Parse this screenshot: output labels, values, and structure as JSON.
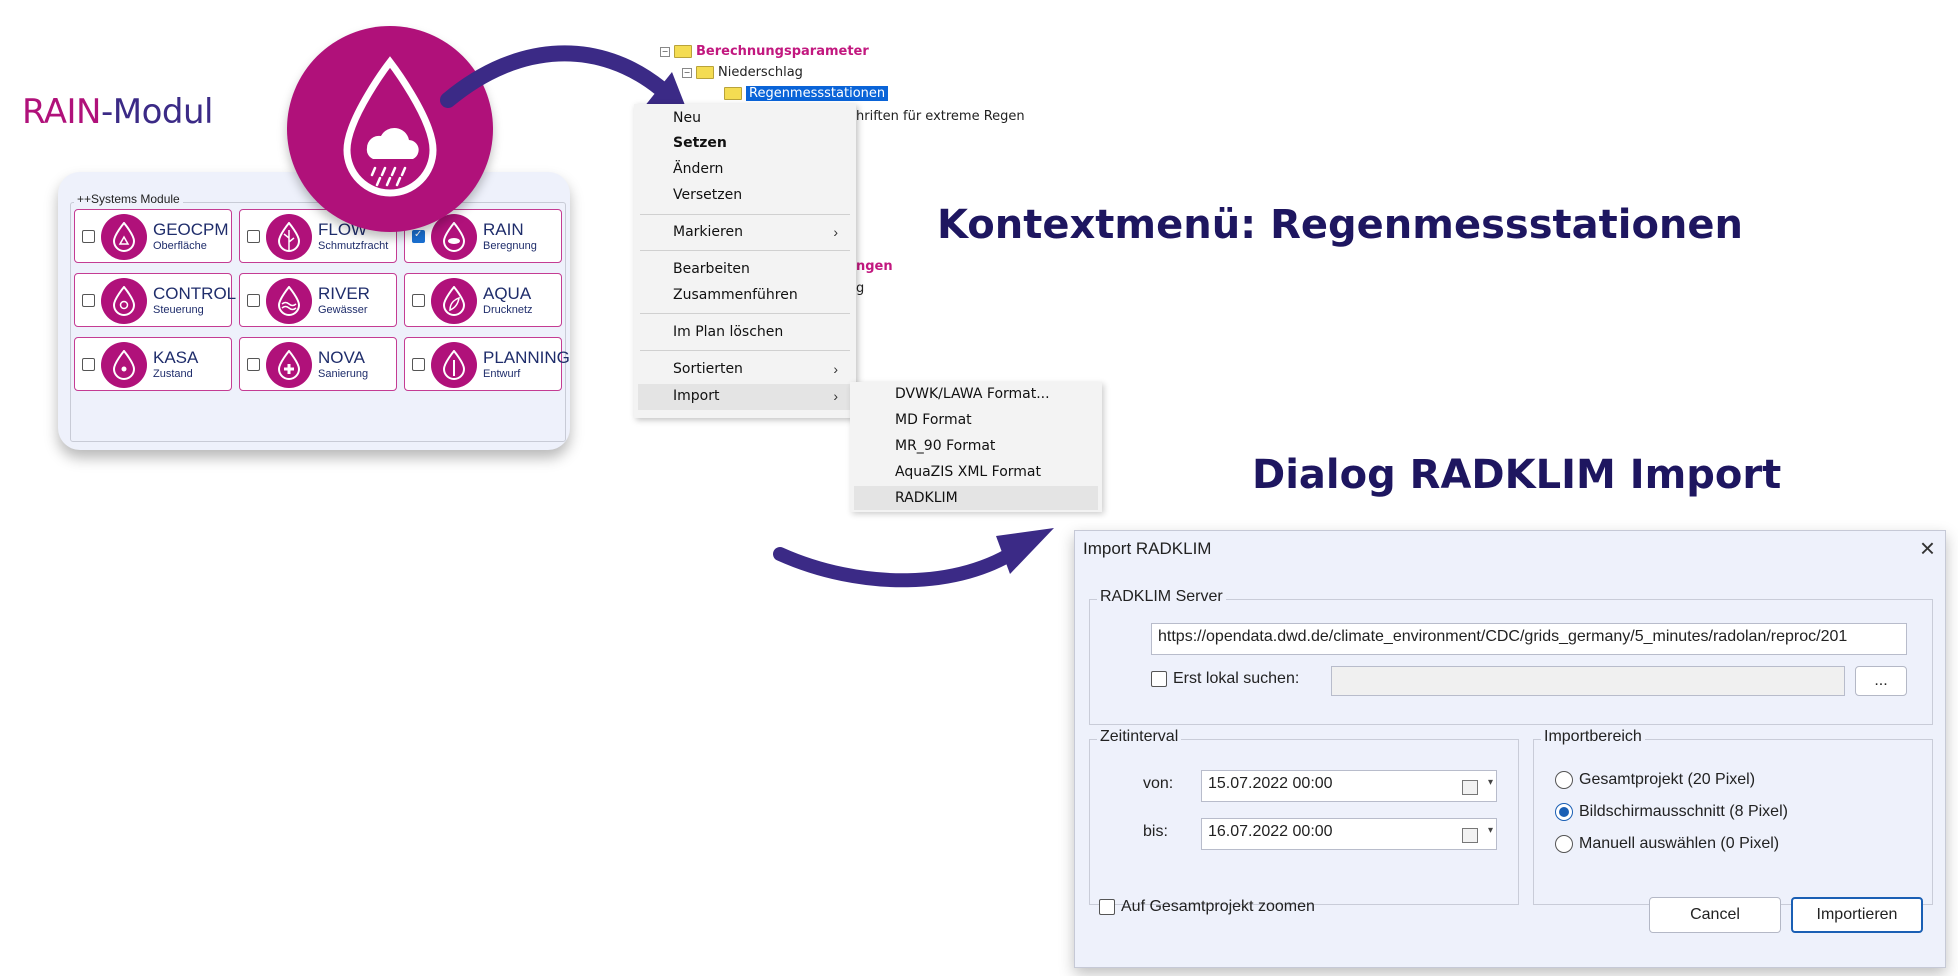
{
  "title": {
    "part1": "RAIN",
    "part2": "-Modul"
  },
  "modules": {
    "legend": "++Systems Module",
    "items": [
      {
        "name": "GEOCPM",
        "sub": "Oberfläche",
        "checked": false
      },
      {
        "name": "FLOW",
        "sub": "Schmutzfracht",
        "checked": false
      },
      {
        "name": "RAIN",
        "sub": "Beregnung",
        "checked": true
      },
      {
        "name": "CONTROL",
        "sub": "Steuerung",
        "checked": false
      },
      {
        "name": "RIVER",
        "sub": "Gewässer",
        "checked": false
      },
      {
        "name": "AQUA",
        "sub": "Drucknetz",
        "checked": false
      },
      {
        "name": "KASA",
        "sub": "Zustand",
        "checked": false
      },
      {
        "name": "NOVA",
        "sub": "Sanierung",
        "checked": false
      },
      {
        "name": "PLANNING",
        "sub": "Entwurf",
        "checked": false
      }
    ]
  },
  "tree": {
    "items": [
      "Berechnungsparameter",
      "Niederschlag",
      "Regenmessstationen"
    ],
    "partial": [
      "hriften für extreme Regen",
      "ngen",
      "g"
    ]
  },
  "context_menu": {
    "items": [
      "Neu",
      "Setzen",
      "Ändern",
      "Versetzen",
      "Markieren",
      "Bearbeiten",
      "Zusammenführen",
      "Im Plan löschen",
      "Sortierten",
      "Import"
    ]
  },
  "submenu": {
    "items": [
      "DVWK/LAWA Format...",
      "MD Format",
      "MR_90 Format",
      "AquaZIS XML Format",
      "RADKLIM"
    ]
  },
  "headings": {
    "context": "Kontextmenü: Regenmessstationen",
    "dialog": "Dialog RADKLIM Import"
  },
  "dialog": {
    "title": "Import RADKLIM",
    "server_legend": "RADKLIM Server",
    "url": "https://opendata.dwd.de/climate_environment/CDC/grids_germany/5_minutes/radolan/reproc/201",
    "local_label": "Erst lokal suchen:",
    "browse_label": "...",
    "time_legend": "Zeitinterval",
    "from_label": "von:",
    "from_value": "15.07.2022 00:00",
    "to_label": "bis:",
    "to_value": "16.07.2022 00:00",
    "area_legend": "Importbereich",
    "area_options": [
      "Gesamtprojekt (20 Pixel)",
      "Bildschirmausschnitt (8 Pixel)",
      "Manuell auswählen (0 Pixel)"
    ],
    "area_selected_index": 1,
    "zoom_label": "Auf Gesamtprojekt zoomen",
    "cancel_label": "Cancel",
    "import_label": "Importieren"
  },
  "colors": {
    "brand_magenta": "#b0117a",
    "brand_navy": "#1e1660",
    "arrow_purple": "#3b2a86",
    "selection_blue": "#0a64d8"
  }
}
